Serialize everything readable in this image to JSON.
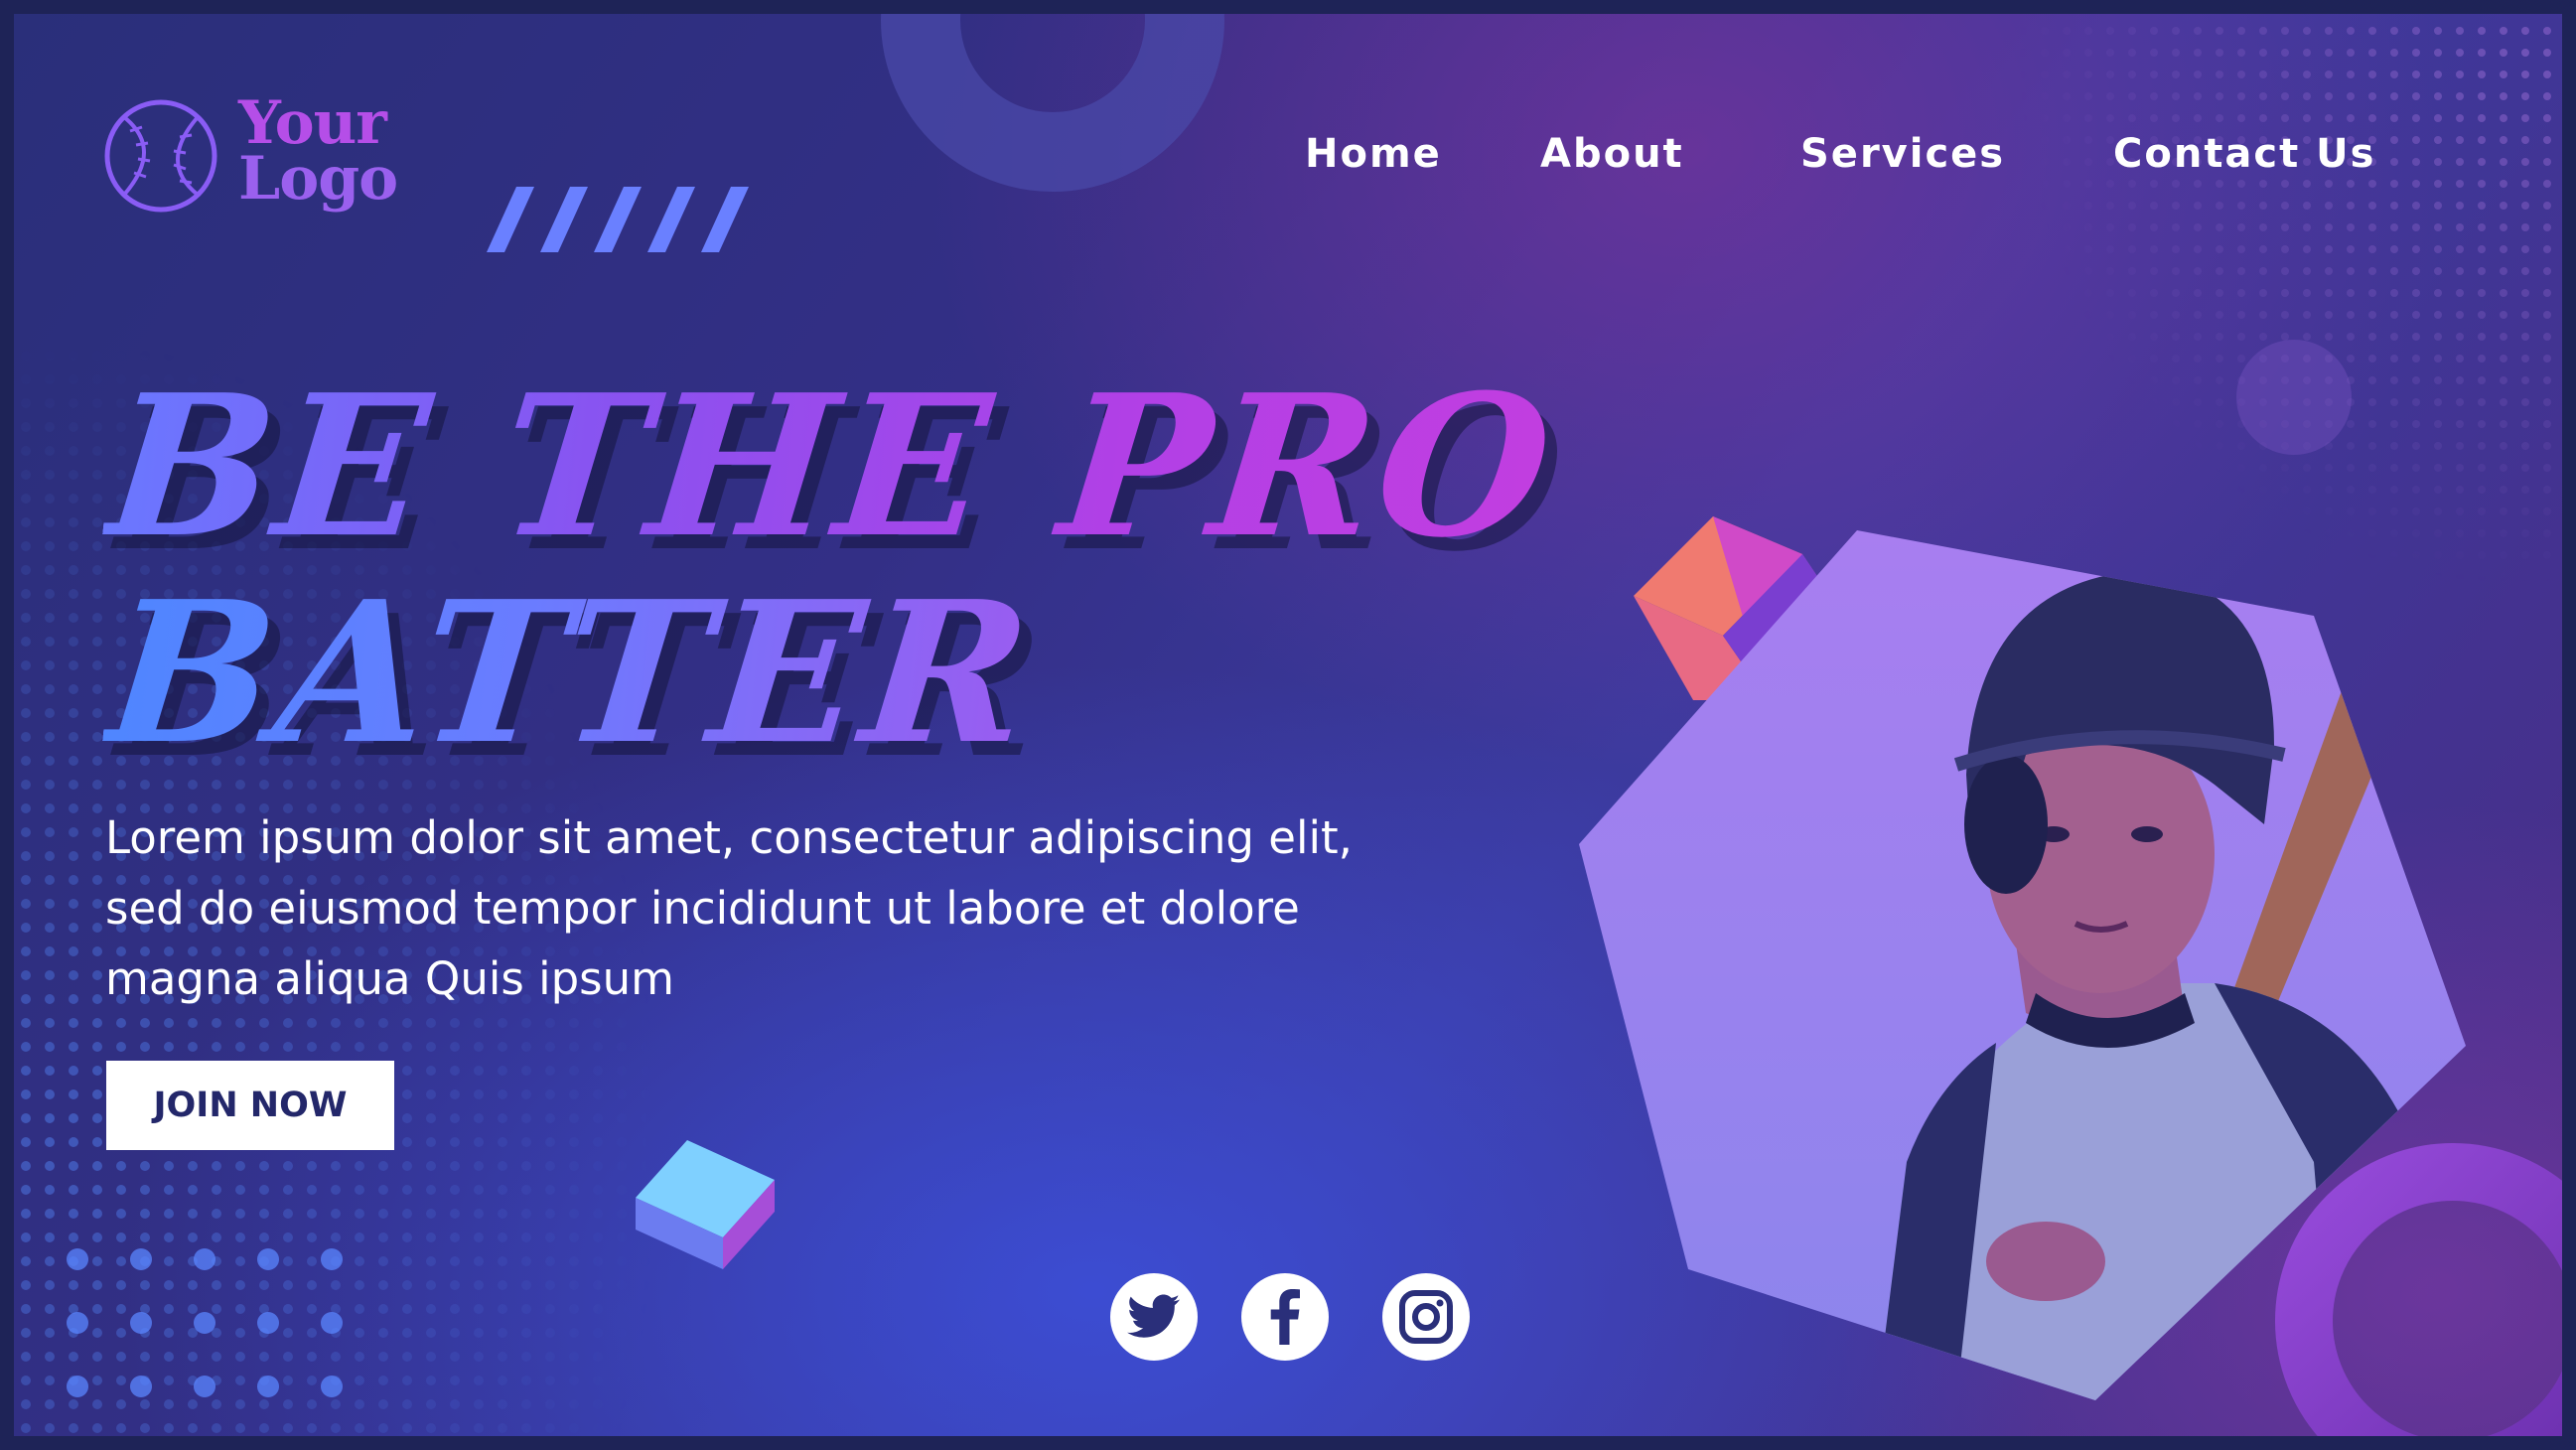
{
  "brand": {
    "logo_line1": "Your",
    "logo_line2": "Logo",
    "logo_icon": "baseball-icon"
  },
  "nav": {
    "items": [
      {
        "label": "Home"
      },
      {
        "label": "About"
      },
      {
        "label": "Services"
      },
      {
        "label": "Contact Us"
      }
    ]
  },
  "hero": {
    "headline_line1": "BE THE PRO",
    "headline_line2": "BATTER",
    "body": "Lorem ipsum dolor sit amet, consectetur adipiscing elit, sed do eiusmod tempor incididunt ut labore et dolore magna aliqua Quis ipsum",
    "cta_label": "JOIN NOW"
  },
  "social": {
    "items": [
      {
        "icon": "twitter-icon"
      },
      {
        "icon": "facebook-icon"
      },
      {
        "icon": "instagram-icon"
      }
    ]
  },
  "colors": {
    "accent_purple": "#b54ee8",
    "accent_blue": "#5a86ff",
    "background": "#2f3286",
    "button_text": "#23276a"
  }
}
